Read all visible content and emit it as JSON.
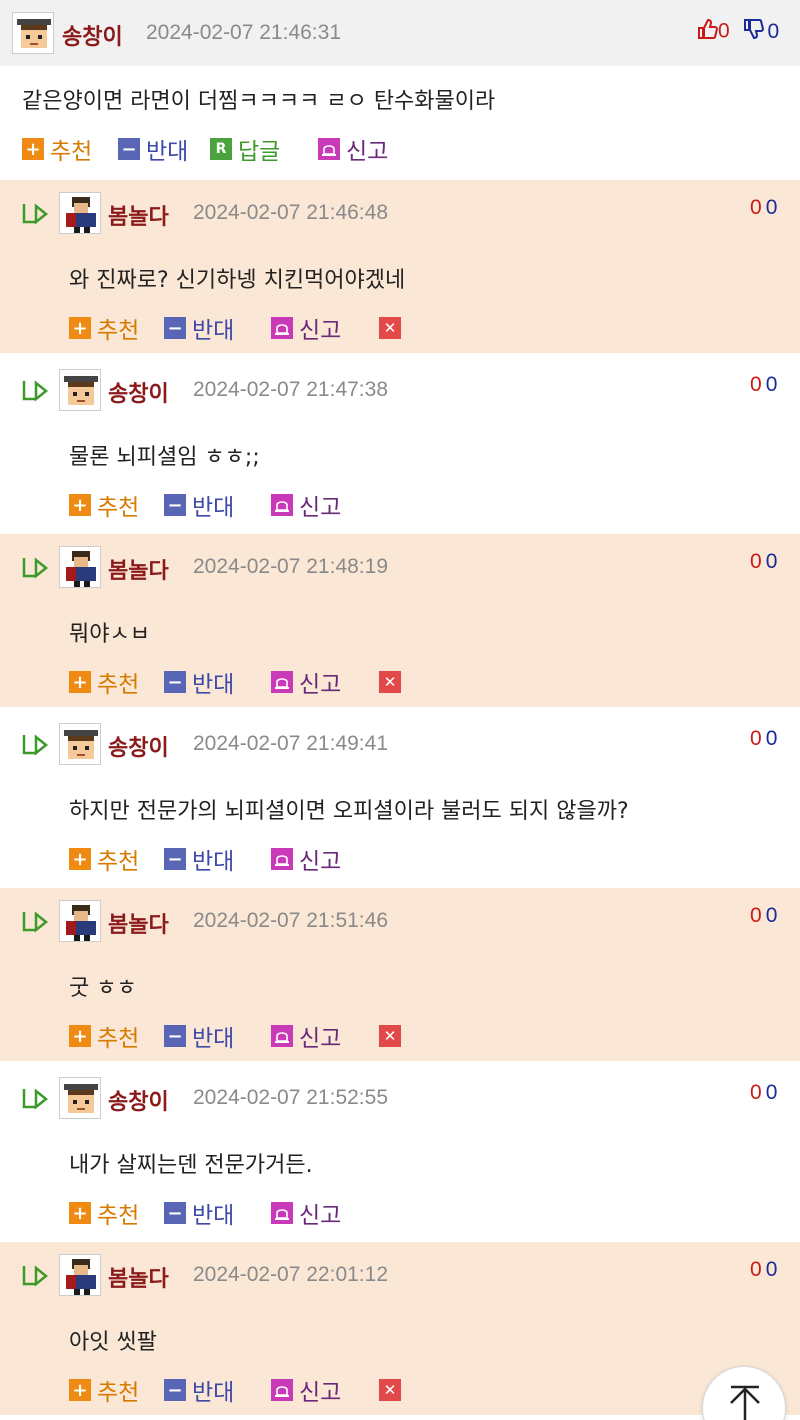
{
  "colors": {
    "reply_bg_peach": "#fbe7d5",
    "reply_bg_white": "#ffffff",
    "nick_color": "#8b1a1a",
    "upvote": "#cc1a1a",
    "downvote": "#1a2a99"
  },
  "actions": {
    "recommend": "추천",
    "oppose": "반대",
    "reply": "답글",
    "report": "신고",
    "reply_badge": "R"
  },
  "root": {
    "nickname": "송창이",
    "timestamp": "2024-02-07 21:46:31",
    "up": "0",
    "down": "0",
    "text": "같은양이면 라면이 더찜ㅋㅋㅋㅋ ㄹㅇ 탄수화물이라"
  },
  "replies": [
    {
      "nickname": "봄놀다",
      "timestamp": "2024-02-07 21:46:48",
      "up": "0",
      "down": "0",
      "text": "와 진짜로? 신기하넹 치킨먹어야겠네"
    },
    {
      "nickname": "송창이",
      "timestamp": "2024-02-07 21:47:38",
      "up": "0",
      "down": "0",
      "text": "물론 뇌피셜임 ㅎㅎ;;"
    },
    {
      "nickname": "봄놀다",
      "timestamp": "2024-02-07 21:48:19",
      "up": "0",
      "down": "0",
      "text": "뭐야ㅅㅂ"
    },
    {
      "nickname": "송창이",
      "timestamp": "2024-02-07 21:49:41",
      "up": "0",
      "down": "0",
      "text": "하지만 전문가의 뇌피셜이면 오피셜이라 불러도 되지 않을까?"
    },
    {
      "nickname": "봄놀다",
      "timestamp": "2024-02-07 21:51:46",
      "up": "0",
      "down": "0",
      "text": "굿 ㅎㅎ"
    },
    {
      "nickname": "송창이",
      "timestamp": "2024-02-07 21:52:55",
      "up": "0",
      "down": "0",
      "text": "내가 살찌는덴 전문가거든."
    },
    {
      "nickname": "봄놀다",
      "timestamp": "2024-02-07 22:01:12",
      "up": "0",
      "down": "0",
      "text": "아잇 씻팔"
    }
  ]
}
